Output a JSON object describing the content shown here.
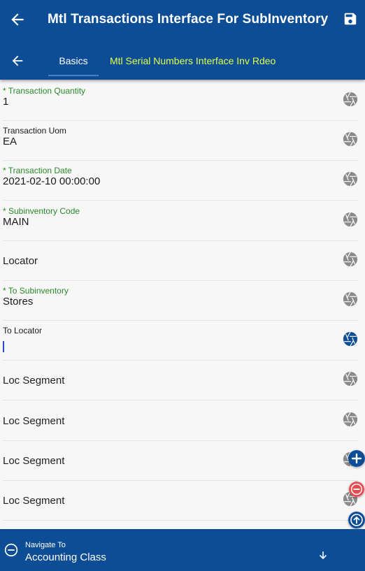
{
  "header": {
    "title": "Mtl Transactions Interface For SubInventory"
  },
  "tabs": [
    {
      "label": "Basics"
    },
    {
      "label": "Mtl Serial Numbers Interface Inv Rdeo"
    }
  ],
  "fields": [
    {
      "label": "* Transaction Quantity",
      "value": "1"
    },
    {
      "label": "Transaction Uom",
      "value": "EA"
    },
    {
      "label": "* Transaction Date",
      "value": "2021-02-10 00:00:00"
    },
    {
      "label": "* Subinventory Code",
      "value": "MAIN"
    },
    {
      "placeholder": "Locator"
    },
    {
      "label": "* To Subinventory",
      "value": "Stores"
    },
    {
      "label": "To Locator",
      "value": ""
    },
    {
      "placeholder": "Loc Segment"
    },
    {
      "placeholder": "Loc Segment"
    },
    {
      "placeholder": "Loc Segment"
    },
    {
      "placeholder": "Loc Segment"
    }
  ],
  "bottom_nav": {
    "label": "Navigate To",
    "value": "Accounting Class"
  },
  "colors": {
    "primary": "#0d4d96",
    "tab_active_text": "#ffffff",
    "tab_inactive_text": "#e0ff4a",
    "required_label": "#2a8a2a",
    "add_fab": "#0d4d96",
    "remove_fab": "#e84a4f"
  },
  "icons": {
    "back": "arrow-left-icon",
    "save": "floppy-disk-icon",
    "field_action": "aperture-icon",
    "add": "plus-circle-icon",
    "remove": "minus-circle-icon",
    "scroll_up": "arrow-up-circle-icon",
    "nav_collapse": "minus-circle-outline-icon",
    "nav_expand": "arrow-down-icon"
  }
}
